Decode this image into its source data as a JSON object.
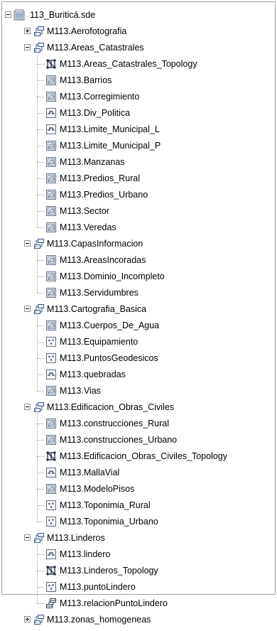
{
  "root": {
    "label": "113_Buriticá.sde",
    "icon": "geodatabase-icon",
    "expanded": true
  },
  "datasets": [
    {
      "label": "M113.Aerofotografia",
      "expanded": false,
      "children": []
    },
    {
      "label": "M113.Areas_Catastrales",
      "expanded": true,
      "children": [
        {
          "label": "M113.Areas_Catastrales_Topology",
          "icon": "topology-icon"
        },
        {
          "label": "M113.Barrios",
          "icon": "polygon-icon"
        },
        {
          "label": "M113.Corregimiento",
          "icon": "polygon-icon"
        },
        {
          "label": "M113.Div_Politica",
          "icon": "line-icon"
        },
        {
          "label": "M113.Limite_Municipal_L",
          "icon": "line-icon"
        },
        {
          "label": "M113.Limite_Municipal_P",
          "icon": "polygon-icon"
        },
        {
          "label": "M113.Manzanas",
          "icon": "polygon-icon"
        },
        {
          "label": "M113.Predios_Rural",
          "icon": "polygon-icon"
        },
        {
          "label": "M113.Predios_Urbano",
          "icon": "polygon-icon"
        },
        {
          "label": "M113.Sector",
          "icon": "polygon-icon"
        },
        {
          "label": "M113.Veredas",
          "icon": "polygon-icon"
        }
      ]
    },
    {
      "label": "M113.CapasInformacion",
      "expanded": true,
      "children": [
        {
          "label": "M113.AreasIncoradas",
          "icon": "polygon-icon"
        },
        {
          "label": "M113.Dominio_Incompleto",
          "icon": "polygon-icon"
        },
        {
          "label": "M113.Servidumbres",
          "icon": "polygon-icon"
        }
      ]
    },
    {
      "label": "M113.Cartografia_Basica",
      "expanded": true,
      "children": [
        {
          "label": "M113.Cuerpos_De_Agua",
          "icon": "polygon-icon"
        },
        {
          "label": "M113.Equipamiento",
          "icon": "point-icon"
        },
        {
          "label": "M113.PuntosGeodesicos",
          "icon": "point-icon"
        },
        {
          "label": "M113.quebradas",
          "icon": "line-icon"
        },
        {
          "label": "M113.Vias",
          "icon": "polygon-icon"
        }
      ]
    },
    {
      "label": "M113.Edificacion_Obras_Civiles",
      "expanded": true,
      "children": [
        {
          "label": "M113.construcciones_Rural",
          "icon": "polygon-icon"
        },
        {
          "label": "M113.construcciones_Urbano",
          "icon": "polygon-icon"
        },
        {
          "label": "M113.Edificacion_Obras_Civiles_Topology",
          "icon": "topology-icon"
        },
        {
          "label": "M113.MallaVial",
          "icon": "line-icon"
        },
        {
          "label": "M113.ModeloPisos",
          "icon": "polygon-icon"
        },
        {
          "label": "M113.Toponimia_Rural",
          "icon": "point-icon"
        },
        {
          "label": "M113.Toponimia_Urbano",
          "icon": "point-icon"
        }
      ]
    },
    {
      "label": "M113.Linderos",
      "expanded": true,
      "children": [
        {
          "label": "M113.lindero",
          "icon": "line-icon"
        },
        {
          "label": "M113.Linderos_Topology",
          "icon": "topology-icon"
        },
        {
          "label": "M113.puntoLindero",
          "icon": "point-icon"
        },
        {
          "label": "M113.relacionPuntoLindero",
          "icon": "relationship-class-icon"
        }
      ]
    },
    {
      "label": "M113.zonas_homogeneas",
      "expanded": false,
      "children": []
    }
  ]
}
